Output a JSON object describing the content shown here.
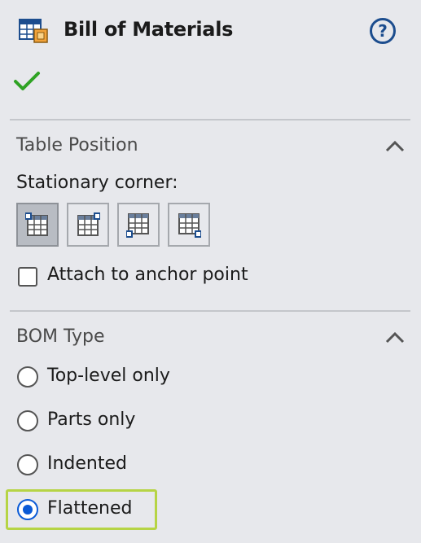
{
  "header": {
    "title": "Bill of Materials",
    "help_glyph": "?",
    "app_icon": "bom-table-icon",
    "ok_icon": "checkmark-icon"
  },
  "table_position": {
    "title": "Table Position",
    "stationary_label": "Stationary corner:",
    "corners": [
      {
        "name": "top-left",
        "selected": true
      },
      {
        "name": "top-right",
        "selected": false
      },
      {
        "name": "bottom-left",
        "selected": false
      },
      {
        "name": "bottom-right",
        "selected": false
      }
    ],
    "attach_label": "Attach to anchor point",
    "attach_checked": false
  },
  "bom_type": {
    "title": "BOM Type",
    "options": [
      {
        "label": "Top-level only",
        "checked": false
      },
      {
        "label": "Parts only",
        "checked": false
      },
      {
        "label": "Indented",
        "checked": false
      },
      {
        "label": "Flattened",
        "checked": true
      }
    ]
  },
  "colors": {
    "accent": "#0a5ad6",
    "help": "#1c4d8e",
    "check": "#2fa324",
    "highlight": "#b6d445",
    "background": "#e7e8ec"
  }
}
